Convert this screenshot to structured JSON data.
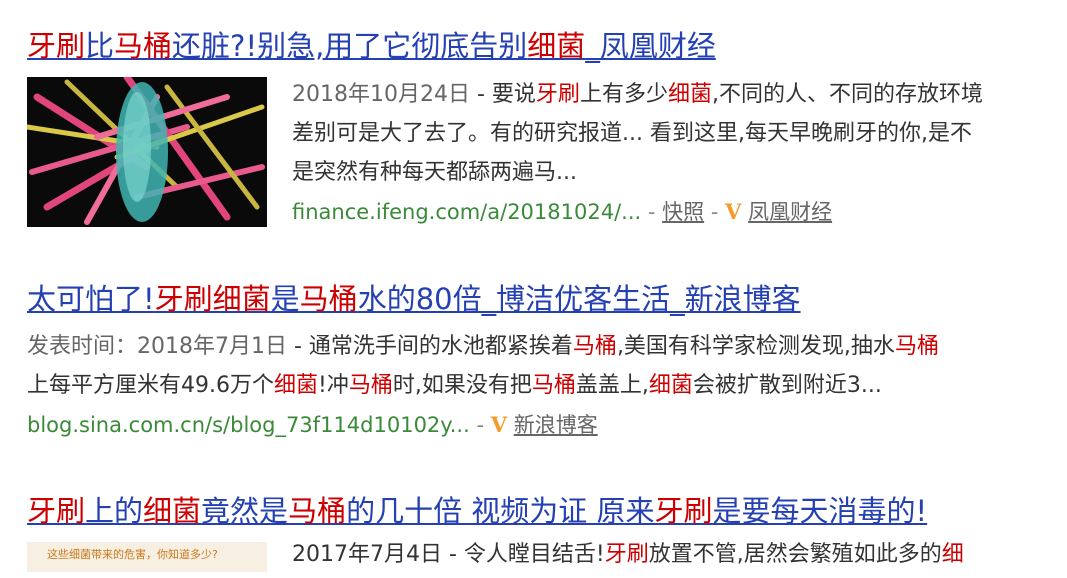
{
  "results": [
    {
      "title_parts": [
        {
          "text": "牙刷",
          "hl": true
        },
        {
          "text": "比",
          "hl": false
        },
        {
          "text": "马桶",
          "hl": true
        },
        {
          "text": "还脏?!别急,用了它彻底告别",
          "hl": false
        },
        {
          "text": "细菌",
          "hl": true
        },
        {
          "text": "_凤凰财经",
          "hl": false
        }
      ],
      "date": "2018年10月24日",
      "line1_parts": [
        {
          "text": " - 要说",
          "hl": false
        },
        {
          "text": "牙刷",
          "hl": true
        },
        {
          "text": "上有多少",
          "hl": false
        },
        {
          "text": "细菌",
          "hl": true
        },
        {
          "text": ",不同的人、不同的存放环境",
          "hl": false
        }
      ],
      "line2": "差别可是大了去了。有的研究报道... 看到这里,每天早晚刷牙的你,是不",
      "line3": "是突然有种每天都舔两遍马...",
      "url": "finance.ifeng.com/a/20181024/...",
      "snapshot": "快照",
      "vmark": "V",
      "source": "凤凰财经"
    },
    {
      "title_parts": [
        {
          "text": "太可怕了!",
          "hl": false
        },
        {
          "text": "牙刷细菌",
          "hl": true
        },
        {
          "text": "是",
          "hl": false
        },
        {
          "text": "马桶",
          "hl": true
        },
        {
          "text": "水的80倍_博洁优客生活_新浪博客",
          "hl": false
        }
      ],
      "date": "发表时间：2018年7月1日",
      "line1_parts": [
        {
          "text": " -  通常洗手间的水池都紧挨着",
          "hl": false
        },
        {
          "text": "马桶",
          "hl": true
        },
        {
          "text": ",美国有科学家检测发现,抽水",
          "hl": false
        },
        {
          "text": "马桶",
          "hl": true
        }
      ],
      "line2_parts": [
        {
          "text": "上每平方厘米有49.6万个",
          "hl": false
        },
        {
          "text": "细菌",
          "hl": true
        },
        {
          "text": "!冲",
          "hl": false
        },
        {
          "text": "马桶",
          "hl": true
        },
        {
          "text": "时,如果没有把",
          "hl": false
        },
        {
          "text": "马桶",
          "hl": true
        },
        {
          "text": "盖盖上,",
          "hl": false
        },
        {
          "text": "细菌",
          "hl": true
        },
        {
          "text": "会被扩散到附近3...",
          "hl": false
        }
      ],
      "url": "blog.sina.com.cn/s/blog_73f114d10102y...",
      "vmark": "V",
      "source": "新浪博客"
    },
    {
      "title_parts": [
        {
          "text": "牙刷",
          "hl": true
        },
        {
          "text": "上的",
          "hl": false
        },
        {
          "text": "细菌",
          "hl": true
        },
        {
          "text": "竟然是",
          "hl": false
        },
        {
          "text": "马桶",
          "hl": true
        },
        {
          "text": "的几十倍 视频为证 原来",
          "hl": false
        },
        {
          "text": "牙刷",
          "hl": true
        },
        {
          "text": "是要每天消毒的!",
          "hl": false
        }
      ],
      "thumb_caption": "这些细菌带来的危害，你知道多少?",
      "line1_parts": [
        {
          "text": "2017年7月4日 - 令人瞠目结舌!",
          "hl": false
        },
        {
          "text": "牙刷",
          "hl": true
        },
        {
          "text": "放置不管,居然会繁殖如此多的",
          "hl": false
        },
        {
          "text": "细",
          "hl": true
        }
      ]
    }
  ],
  "colors": {
    "title": "#2440b3",
    "highlight": "#cc0000",
    "url": "#3a8a3a",
    "vmark": "#f39b2c"
  }
}
